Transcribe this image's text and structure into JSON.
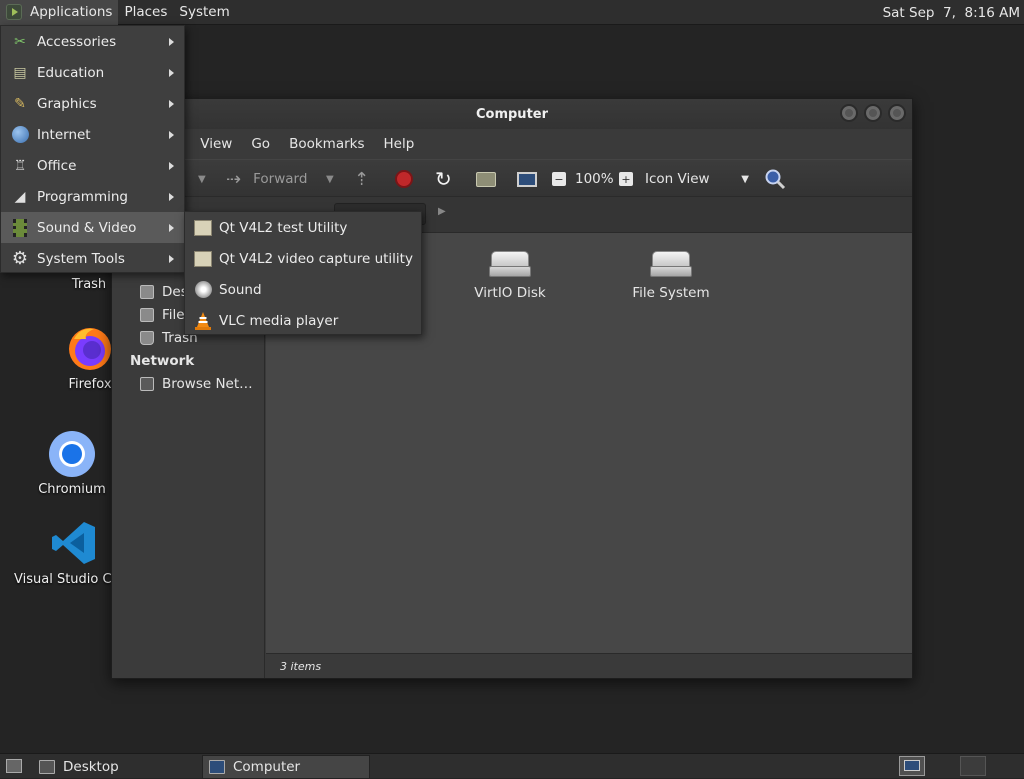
{
  "top_panel": {
    "menus": [
      "Applications",
      "Places",
      "System"
    ],
    "clock": "Sat Sep  7,  8:16 AM"
  },
  "apps_menu": {
    "items": [
      {
        "label": "Accessories",
        "icon": "accessories-icon"
      },
      {
        "label": "Education",
        "icon": "education-icon"
      },
      {
        "label": "Graphics",
        "icon": "graphics-icon"
      },
      {
        "label": "Internet",
        "icon": "internet-globe-icon"
      },
      {
        "label": "Office",
        "icon": "office-icon"
      },
      {
        "label": "Programming",
        "icon": "programming-icon"
      },
      {
        "label": "Sound & Video",
        "icon": "film-strip-icon"
      },
      {
        "label": "System Tools",
        "icon": "gear-icon"
      }
    ],
    "highlighted": "Sound & Video"
  },
  "sub_menu": {
    "items": [
      {
        "label": "Qt V4L2 test Utility",
        "icon": "generic-app-icon"
      },
      {
        "label": "Qt V4L2 video capture utility",
        "icon": "generic-app-icon"
      },
      {
        "label": "Sound",
        "icon": "speaker-icon"
      },
      {
        "label": "VLC media player",
        "icon": "vlc-cone-icon"
      }
    ]
  },
  "desktop": {
    "icons": [
      {
        "label": "Trash",
        "icon": "trash-icon"
      },
      {
        "label": "Firefox",
        "icon": "firefox-icon"
      },
      {
        "label": "Chromium",
        "icon": "chromium-icon"
      },
      {
        "label": "Visual Studio Co",
        "icon": "vscode-icon"
      }
    ]
  },
  "file_manager": {
    "title": "Computer",
    "menubar": [
      "t",
      "View",
      "Go",
      "Bookmarks",
      "Help"
    ],
    "toolbar": {
      "forward": "Forward",
      "zoom": "100%",
      "view_mode": "Icon View"
    },
    "sidebar": {
      "items": [
        {
          "label": "Des",
          "icon": "desktop-folder-icon"
        },
        {
          "label": "File",
          "icon": "filesystem-icon"
        },
        {
          "label": "Trash",
          "icon": "trash-icon"
        }
      ],
      "network_header": "Network",
      "network_items": [
        {
          "label": "Browse Net…",
          "icon": "network-icon"
        }
      ]
    },
    "content": {
      "items": [
        {
          "label": "VirtIO Disk",
          "icon": "drive-icon"
        },
        {
          "label": "File System",
          "icon": "drive-icon"
        }
      ]
    },
    "status": "3 items"
  },
  "bottom_panel": {
    "tasks": [
      {
        "label": "Desktop",
        "icon": "desktop-icon"
      },
      {
        "label": "Computer",
        "icon": "computer-icon"
      }
    ]
  },
  "colors": {
    "panel_bg": "#2e2e2e",
    "menu_bg": "#3f3f3f",
    "menu_highlight": "#5a5a5a",
    "window_content": "#474747"
  }
}
